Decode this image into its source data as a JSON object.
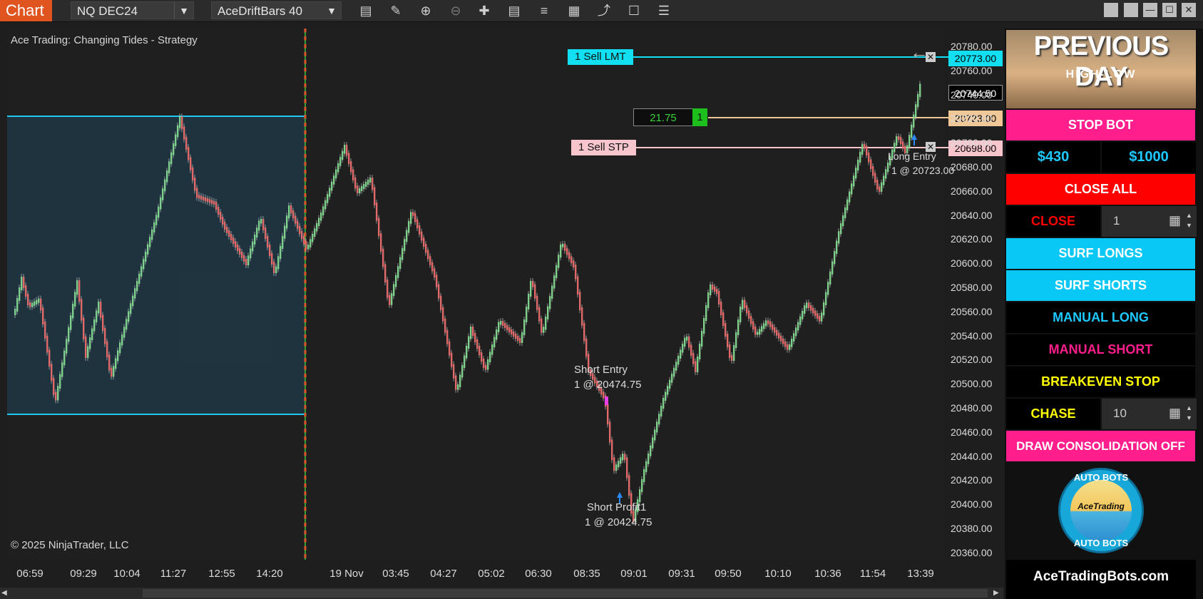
{
  "toolbar": {
    "chart_tab": "Chart",
    "instrument": "NQ DEC24",
    "bar_type": "AceDriftBars 40",
    "icons": [
      "bar-style-icon",
      "draw-icon",
      "zoom-in-icon",
      "zoom-out-icon",
      "crosshair-icon",
      "data-box-icon",
      "properties-icon",
      "indicators-icon",
      "strategies-icon",
      "templates-icon",
      "list-icon"
    ]
  },
  "chart": {
    "strategy_label": "Ace Trading: Changing Tides - Strategy",
    "copyright": "© 2025 NinjaTrader, LLC",
    "price_ticks": [
      "20780.00",
      "20760.00",
      "20740.00",
      "20720.00",
      "20700.00",
      "20680.00",
      "20660.00",
      "20640.00",
      "20620.00",
      "20600.00",
      "20580.00",
      "20560.00",
      "20540.00",
      "20520.00",
      "20500.00",
      "20480.00",
      "20460.00",
      "20440.00",
      "20420.00",
      "20400.00",
      "20380.00",
      "20360.00"
    ],
    "time_ticks": [
      "06:59",
      "09:29",
      "10:04",
      "11:27",
      "12:55",
      "14:20",
      "19 Nov",
      "03:45",
      "04:27",
      "05:02",
      "06:30",
      "08:35",
      "09:01",
      "09:31",
      "09:50",
      "10:10",
      "10:36",
      "11:54",
      "13:39"
    ],
    "orders": {
      "sell_lmt_label": "1 Sell LMT",
      "sell_lmt_price": "20773.00",
      "last_price": "20744.50",
      "position_pnl": "21.75",
      "position_qty": "1",
      "position_price": "20723.00",
      "sell_stp_label": "1 Sell STP",
      "sell_stp_price": "20698.00"
    },
    "annotations": {
      "short_entry_1": "Short  Entry",
      "short_entry_2": "1 @ 20474.75",
      "short_profit_1": "Short Profit1",
      "short_profit_2": "1 @ 20424.75",
      "long_entry_1": "Long  Entry",
      "long_entry_2": "1 @ 20723.00"
    }
  },
  "panel": {
    "banner_title": "PREVIOUS DAY",
    "banner_sub": "HIGH-LOW",
    "stop_bot": "STOP BOT",
    "amount_1": "$430",
    "amount_2": "$1000",
    "close_all": "CLOSE ALL",
    "close_label": "CLOSE",
    "close_qty": "1",
    "surf_longs": "SURF LONGS",
    "surf_shorts": "SURF SHORTS",
    "manual_long": "MANUAL LONG",
    "manual_short": "MANUAL SHORT",
    "breakeven_stop": "BREAKEVEN STOP",
    "chase_label": "CHASE",
    "chase_qty": "10",
    "draw_consolidation": "DRAW CONSOLIDATION OFF",
    "logo_top": "AUTO BOTS",
    "logo_mid": "AceTrading",
    "logo_bottom": "AUTO BOTS",
    "website": "AceTradingBots.com"
  },
  "colors": {
    "accent": "#e0541f",
    "cyan": "#00c8ff",
    "pink": "#ff1e8c",
    "red": "#ff0000",
    "yellow": "#ffff00",
    "up_bar": "#7fd08c",
    "down_bar": "#e06a6a"
  }
}
